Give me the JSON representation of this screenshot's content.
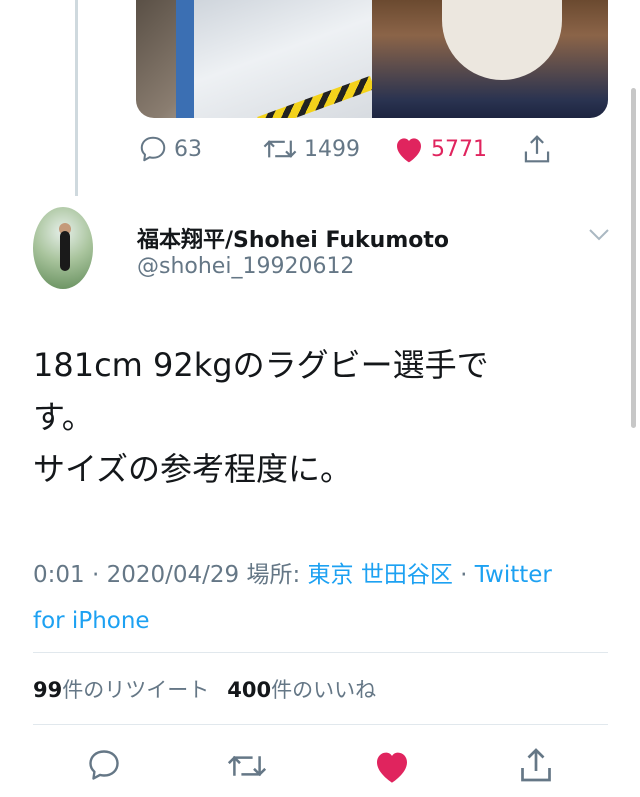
{
  "prev_tweet": {
    "actions": {
      "reply_count": "63",
      "retweet_count": "1499",
      "like_count": "5771"
    }
  },
  "tweet": {
    "display_name": "福本翔平/Shohei Fukumoto",
    "handle": "@shohei_19920612",
    "text_lines": [
      "181cm 92kgのラグビー選手で",
      "す。",
      "サイズの参考程度に。"
    ],
    "time": "0:01 · 2020/04/29 ",
    "location_prefix": "場所: ",
    "location": "東京 世田谷区",
    "source_sep": " · ",
    "source_part1": "Twitter",
    "source_part2": "for iPhone",
    "retweets_num": "99",
    "retweets_label": "件のリツイート",
    "likes_num": "400",
    "likes_label": "件のいいね"
  },
  "colors": {
    "link": "#1da1f2",
    "like": "#e0245e",
    "secondary_text": "#657786"
  },
  "icons": [
    "reply-icon",
    "retweet-icon",
    "heart-icon",
    "share-icon",
    "chevron-down-icon"
  ]
}
